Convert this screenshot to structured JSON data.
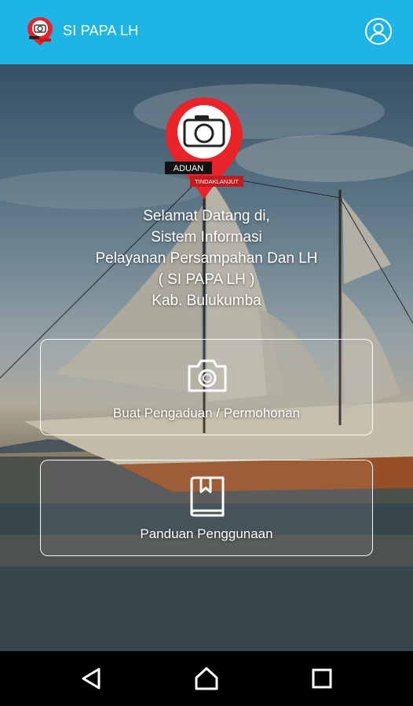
{
  "appbar": {
    "title": "SI PAPA LH",
    "logo_icon": "report-pin-logo-icon",
    "profile_icon": "account-circle-icon",
    "color": "#1eb4e6"
  },
  "hero": {
    "pin_icon": "camera-pin-icon",
    "badge_top": "ADUAN",
    "badge_bottom": "TINDAKLANJUT",
    "pin_color": "#e8242a"
  },
  "welcome": {
    "line1": "Selamat Datang di,",
    "line2": "Sistem Informasi",
    "line3": "Pelayanan Persampahan Dan LH",
    "line4": "( SI PAPA LH )",
    "line5": "Kab. Bulukumba"
  },
  "menu": {
    "complaint_label": "Buat Pengaduan / Permohonan",
    "complaint_icon": "camera-icon",
    "guide_label": "Panduan Penggunaan",
    "guide_icon": "book-icon"
  },
  "system_nav": {
    "back_icon": "back-triangle-icon",
    "home_icon": "home-icon",
    "recents_icon": "recents-square-icon"
  }
}
